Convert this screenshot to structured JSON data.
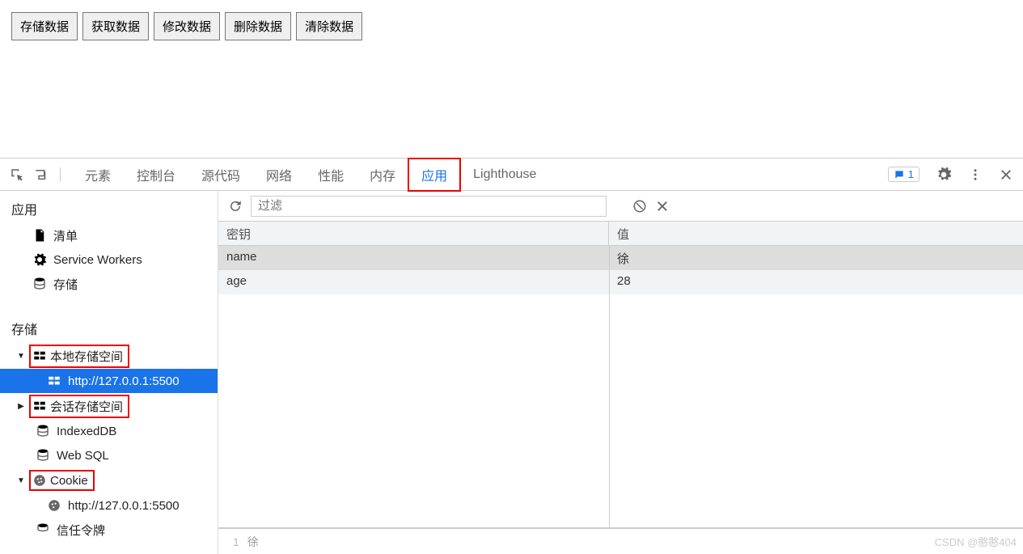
{
  "page_buttons": [
    "存储数据",
    "获取数据",
    "修改数据",
    "删除数据",
    "清除数据"
  ],
  "devtools": {
    "tabs": [
      "元素",
      "控制台",
      "源代码",
      "网络",
      "性能",
      "内存",
      "应用",
      "Lighthouse"
    ],
    "active_tab_index": 6,
    "messages_count": "1"
  },
  "sidebar": {
    "app_section": "应用",
    "app_items": {
      "manifest": "清单",
      "sw": "Service Workers",
      "storage": "存储"
    },
    "storage_section": "存储",
    "tree": {
      "local_storage": "本地存储空间",
      "local_storage_child": "http://127.0.0.1:5500",
      "session_storage": "会话存储空间",
      "indexeddb": "IndexedDB",
      "websql": "Web SQL",
      "cookie": "Cookie",
      "cookie_child": "http://127.0.0.1:5500",
      "trust": "信任令牌"
    }
  },
  "content": {
    "filter_placeholder": "过滤",
    "columns": {
      "key": "密钥",
      "value": "值"
    },
    "rows": [
      {
        "key": "name",
        "value": "徐"
      },
      {
        "key": "age",
        "value": "28"
      }
    ],
    "viewer": {
      "line": "1",
      "text": "徐"
    }
  },
  "watermark": "CSDN @憨憨404"
}
